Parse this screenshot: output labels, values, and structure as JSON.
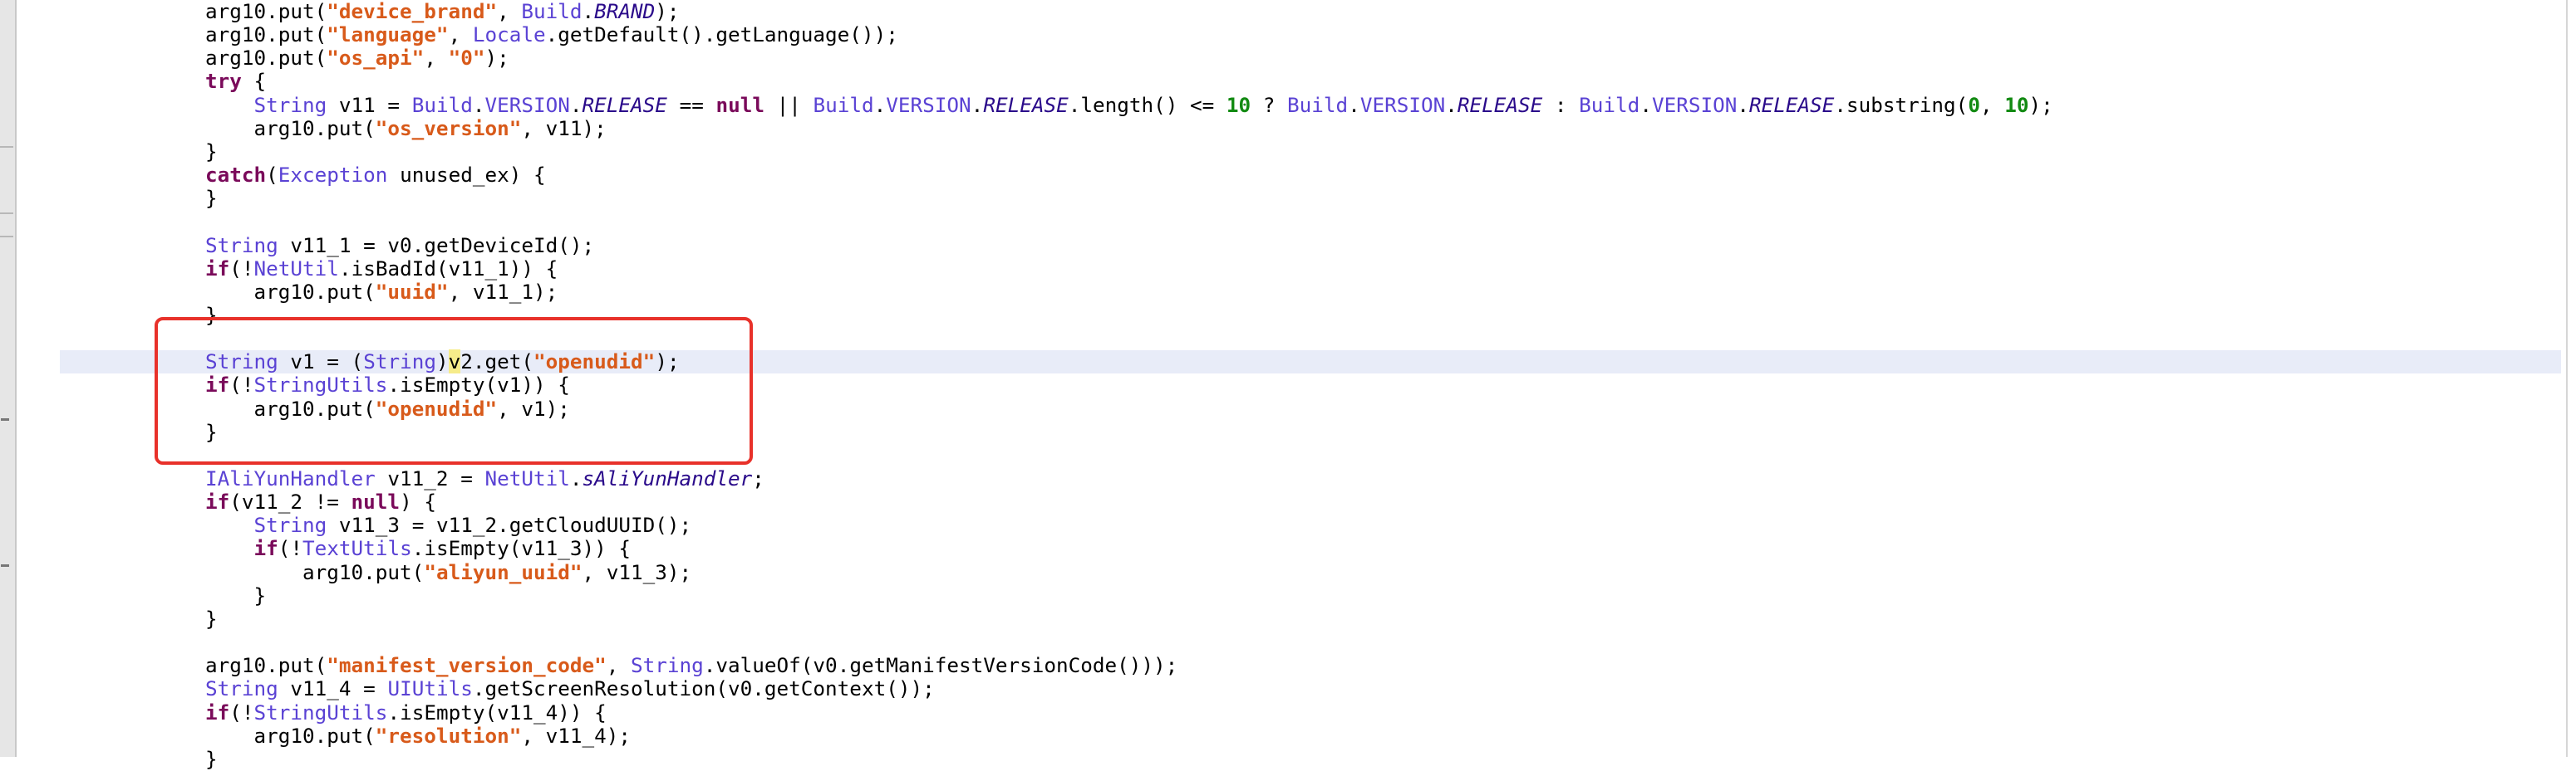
{
  "colors": {
    "keyword": "#7a0a5a",
    "type": "#5a42d4",
    "string": "#d85a1a",
    "number": "#128a12",
    "field": "#2a0a8a",
    "caret_line": "#e8ecf8",
    "annotation_box": "#e8312a"
  },
  "code_lines": [
    {
      "indent": "",
      "tokens": [
        {
          "t": "arg10.put(",
          "k": "plain"
        },
        {
          "t": "\"device_brand\"",
          "k": "str"
        },
        {
          "t": ", ",
          "k": "plain"
        },
        {
          "t": "Build",
          "k": "type"
        },
        {
          "t": ".",
          "k": "plain"
        },
        {
          "t": "BRAND",
          "k": "ital"
        },
        {
          "t": ");",
          "k": "plain"
        }
      ]
    },
    {
      "indent": "",
      "tokens": [
        {
          "t": "arg10.put(",
          "k": "plain"
        },
        {
          "t": "\"language\"",
          "k": "str"
        },
        {
          "t": ", ",
          "k": "plain"
        },
        {
          "t": "Locale",
          "k": "type"
        },
        {
          "t": ".getDefault().getLanguage());",
          "k": "plain"
        }
      ]
    },
    {
      "indent": "",
      "tokens": [
        {
          "t": "arg10.put(",
          "k": "plain"
        },
        {
          "t": "\"os_api\"",
          "k": "str"
        },
        {
          "t": ", ",
          "k": "plain"
        },
        {
          "t": "\"0\"",
          "k": "str"
        },
        {
          "t": ");",
          "k": "plain"
        }
      ]
    },
    {
      "indent": "",
      "tokens": [
        {
          "t": "try",
          "k": "kw"
        },
        {
          "t": " {",
          "k": "plain"
        }
      ]
    },
    {
      "indent": "    ",
      "tokens": [
        {
          "t": "String",
          "k": "type"
        },
        {
          "t": " v11 = ",
          "k": "plain"
        },
        {
          "t": "Build",
          "k": "type"
        },
        {
          "t": ".",
          "k": "plain"
        },
        {
          "t": "VERSION",
          "k": "type"
        },
        {
          "t": ".",
          "k": "plain"
        },
        {
          "t": "RELEASE",
          "k": "ital"
        },
        {
          "t": " == ",
          "k": "plain"
        },
        {
          "t": "null",
          "k": "kw"
        },
        {
          "t": " || ",
          "k": "plain"
        },
        {
          "t": "Build",
          "k": "type"
        },
        {
          "t": ".",
          "k": "plain"
        },
        {
          "t": "VERSION",
          "k": "type"
        },
        {
          "t": ".",
          "k": "plain"
        },
        {
          "t": "RELEASE",
          "k": "ital"
        },
        {
          "t": ".length() <= ",
          "k": "plain"
        },
        {
          "t": "10",
          "k": "num"
        },
        {
          "t": " ? ",
          "k": "plain"
        },
        {
          "t": "Build",
          "k": "type"
        },
        {
          "t": ".",
          "k": "plain"
        },
        {
          "t": "VERSION",
          "k": "type"
        },
        {
          "t": ".",
          "k": "plain"
        },
        {
          "t": "RELEASE",
          "k": "ital"
        },
        {
          "t": " : ",
          "k": "plain"
        },
        {
          "t": "Build",
          "k": "type"
        },
        {
          "t": ".",
          "k": "plain"
        },
        {
          "t": "VERSION",
          "k": "type"
        },
        {
          "t": ".",
          "k": "plain"
        },
        {
          "t": "RELEASE",
          "k": "ital"
        },
        {
          "t": ".substring(",
          "k": "plain"
        },
        {
          "t": "0",
          "k": "num"
        },
        {
          "t": ", ",
          "k": "plain"
        },
        {
          "t": "10",
          "k": "num"
        },
        {
          "t": ");",
          "k": "plain"
        }
      ]
    },
    {
      "indent": "    ",
      "tokens": [
        {
          "t": "arg10.put(",
          "k": "plain"
        },
        {
          "t": "\"os_version\"",
          "k": "str"
        },
        {
          "t": ", v11);",
          "k": "plain"
        }
      ]
    },
    {
      "indent": "",
      "tokens": [
        {
          "t": "}",
          "k": "plain"
        }
      ]
    },
    {
      "indent": "",
      "tokens": [
        {
          "t": "catch",
          "k": "kw"
        },
        {
          "t": "(",
          "k": "plain"
        },
        {
          "t": "Exception",
          "k": "type"
        },
        {
          "t": " unused_ex) {",
          "k": "plain"
        }
      ]
    },
    {
      "indent": "",
      "tokens": [
        {
          "t": "}",
          "k": "plain"
        }
      ]
    },
    {
      "indent": "",
      "tokens": []
    },
    {
      "indent": "",
      "tokens": [
        {
          "t": "String",
          "k": "type"
        },
        {
          "t": " v11_1 = v0.getDeviceId();",
          "k": "plain"
        }
      ]
    },
    {
      "indent": "",
      "tokens": [
        {
          "t": "if",
          "k": "kw"
        },
        {
          "t": "(!",
          "k": "plain"
        },
        {
          "t": "NetUtil",
          "k": "type"
        },
        {
          "t": ".isBadId(v11_1)) {",
          "k": "plain"
        }
      ]
    },
    {
      "indent": "    ",
      "tokens": [
        {
          "t": "arg10.put(",
          "k": "plain"
        },
        {
          "t": "\"uuid\"",
          "k": "str"
        },
        {
          "t": ", v11_1);",
          "k": "plain"
        }
      ]
    },
    {
      "indent": "",
      "tokens": [
        {
          "t": "}",
          "k": "plain"
        }
      ]
    },
    {
      "indent": "",
      "tokens": []
    },
    {
      "indent": "",
      "caret": true,
      "tokens": [
        {
          "t": "String",
          "k": "type"
        },
        {
          "t": " v1 = (",
          "k": "plain"
        },
        {
          "t": "String",
          "k": "type"
        },
        {
          "t": ")",
          "k": "plain"
        },
        {
          "t": "v",
          "k": "caret"
        },
        {
          "t": "2.get(",
          "k": "plain"
        },
        {
          "t": "\"openudid\"",
          "k": "str"
        },
        {
          "t": ");",
          "k": "plain"
        }
      ]
    },
    {
      "indent": "",
      "tokens": [
        {
          "t": "if",
          "k": "kw"
        },
        {
          "t": "(!",
          "k": "plain"
        },
        {
          "t": "StringUtils",
          "k": "type"
        },
        {
          "t": ".isEmpty(v1)) {",
          "k": "plain"
        }
      ]
    },
    {
      "indent": "    ",
      "tokens": [
        {
          "t": "arg10.put(",
          "k": "plain"
        },
        {
          "t": "\"openudid\"",
          "k": "str"
        },
        {
          "t": ", v1);",
          "k": "plain"
        }
      ]
    },
    {
      "indent": "",
      "tokens": [
        {
          "t": "}",
          "k": "plain"
        }
      ]
    },
    {
      "indent": "",
      "tokens": []
    },
    {
      "indent": "",
      "tokens": [
        {
          "t": "IAliYunHandler",
          "k": "type"
        },
        {
          "t": " v11_2 = ",
          "k": "plain"
        },
        {
          "t": "NetUtil",
          "k": "type"
        },
        {
          "t": ".",
          "k": "plain"
        },
        {
          "t": "sAliYunHandler",
          "k": "ital"
        },
        {
          "t": ";",
          "k": "plain"
        }
      ]
    },
    {
      "indent": "",
      "tokens": [
        {
          "t": "if",
          "k": "kw"
        },
        {
          "t": "(v11_2 != ",
          "k": "plain"
        },
        {
          "t": "null",
          "k": "kw"
        },
        {
          "t": ") {",
          "k": "plain"
        }
      ]
    },
    {
      "indent": "    ",
      "tokens": [
        {
          "t": "String",
          "k": "type"
        },
        {
          "t": " v11_3 = v11_2.getCloudUUID();",
          "k": "plain"
        }
      ]
    },
    {
      "indent": "    ",
      "tokens": [
        {
          "t": "if",
          "k": "kw"
        },
        {
          "t": "(!",
          "k": "plain"
        },
        {
          "t": "TextUtils",
          "k": "type"
        },
        {
          "t": ".isEmpty(v11_3)) {",
          "k": "plain"
        }
      ]
    },
    {
      "indent": "        ",
      "tokens": [
        {
          "t": "arg10.put(",
          "k": "plain"
        },
        {
          "t": "\"aliyun_uuid\"",
          "k": "str"
        },
        {
          "t": ", v11_3);",
          "k": "plain"
        }
      ]
    },
    {
      "indent": "    ",
      "tokens": [
        {
          "t": "}",
          "k": "plain"
        }
      ]
    },
    {
      "indent": "",
      "tokens": [
        {
          "t": "}",
          "k": "plain"
        }
      ]
    },
    {
      "indent": "",
      "tokens": []
    },
    {
      "indent": "",
      "tokens": [
        {
          "t": "arg10.put(",
          "k": "plain"
        },
        {
          "t": "\"manifest_version_code\"",
          "k": "str"
        },
        {
          "t": ", ",
          "k": "plain"
        },
        {
          "t": "String",
          "k": "type"
        },
        {
          "t": ".valueOf(v0.getManifestVersionCode()));",
          "k": "plain"
        }
      ]
    },
    {
      "indent": "",
      "tokens": [
        {
          "t": "String",
          "k": "type"
        },
        {
          "t": " v11_4 = ",
          "k": "plain"
        },
        {
          "t": "UIUtils",
          "k": "type"
        },
        {
          "t": ".getScreenResolution(v0.getContext());",
          "k": "plain"
        }
      ]
    },
    {
      "indent": "",
      "tokens": [
        {
          "t": "if",
          "k": "kw"
        },
        {
          "t": "(!",
          "k": "plain"
        },
        {
          "t": "StringUtils",
          "k": "type"
        },
        {
          "t": ".isEmpty(v11_4)) {",
          "k": "plain"
        }
      ]
    },
    {
      "indent": "    ",
      "tokens": [
        {
          "t": "arg10.put(",
          "k": "plain"
        },
        {
          "t": "\"resolution\"",
          "k": "str"
        },
        {
          "t": ", v11_4);",
          "k": "plain"
        }
      ]
    },
    {
      "indent": "",
      "tokens": [
        {
          "t": "}",
          "k": "plain"
        }
      ]
    }
  ]
}
